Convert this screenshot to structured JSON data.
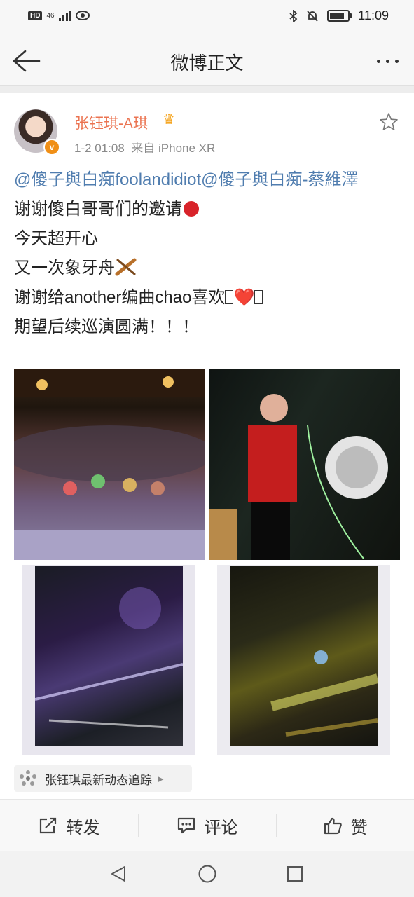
{
  "status_bar": {
    "hd": "HD",
    "network": "46",
    "time": "11:09"
  },
  "nav": {
    "title": "微博正文"
  },
  "post": {
    "author": "张钰琪-A琪",
    "time": "1-2 01:08",
    "source": "来自 iPhone XR",
    "mention_line": "@傻子與白痴foolandidiot@傻子與白痴-蔡維澤",
    "line1": "谢谢傻白哥哥们的邀请",
    "line2": "今天超开心",
    "line3": "又一次象牙舟",
    "line4_pre": "谢谢给another编曲chao喜欢",
    "line4_heart": "❤️",
    "line5": "期望后续巡演圆满！！！"
  },
  "follow_chip": {
    "label": "张钰琪最新动态追踪"
  },
  "actions": {
    "repost": "转发",
    "comment": "评论",
    "like": "赞"
  },
  "icons": [
    "back-arrow-icon",
    "more-icon",
    "star-icon",
    "verified-badge-icon",
    "crown-icon",
    "apple-emoji-icon",
    "canoe-emoji-icon",
    "heart-emoji-icon",
    "repost-icon",
    "comment-icon",
    "like-icon",
    "sys-back-icon",
    "sys-home-icon",
    "sys-recent-icon"
  ],
  "colors": {
    "author": "#eb7350",
    "mention": "#507daf",
    "verified": "#f08f16"
  }
}
